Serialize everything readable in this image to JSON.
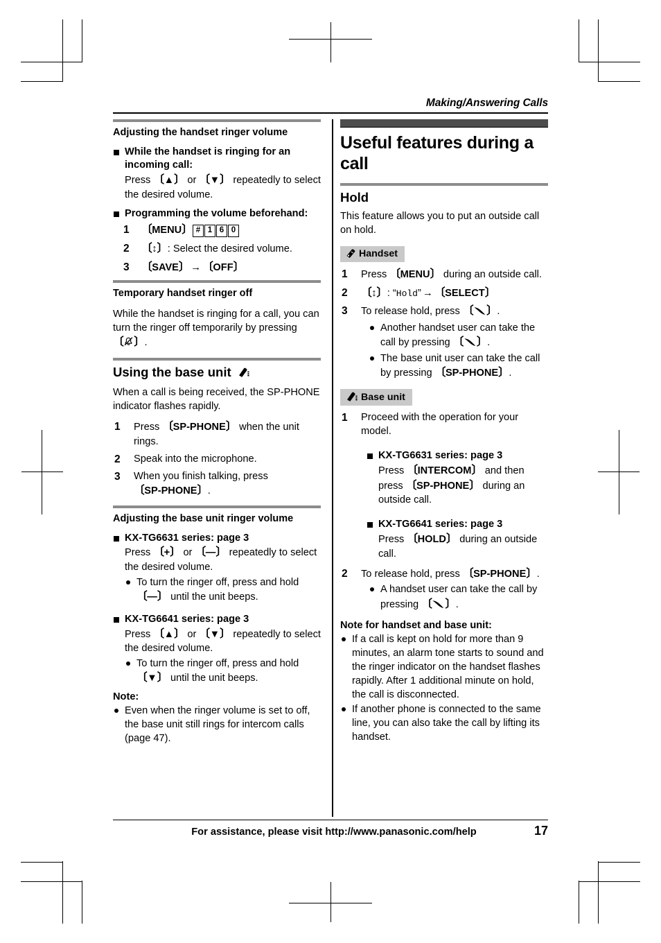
{
  "running_head": "Making/Answering Calls",
  "left_column": {
    "section1": {
      "heading": "Adjusting the handset ringer volume",
      "block1": {
        "heading": "While the handset is ringing for an incoming call:",
        "text_pre": "Press ",
        "key_up": "▲",
        "text_or": " or ",
        "key_down": "▼",
        "text_post": " repeatedly to select the desired volume."
      },
      "block2": {
        "heading": "Programming the volume beforehand:",
        "steps": [
          {
            "num": "1",
            "key": "MENU",
            "keypad": [
              "#",
              "1",
              "6",
              "0"
            ]
          },
          {
            "num": "2",
            "key_nav": "↕",
            "text": ": Select the desired volume."
          },
          {
            "num": "3",
            "key_a": "SAVE",
            "arrow": "→",
            "key_b": "OFF"
          }
        ]
      }
    },
    "section2": {
      "heading": "Temporary handset ringer off",
      "text_pre": "While the handset is ringing for a call, you can turn the ringer off temporarily by pressing ",
      "icon": "ringer-off-icon",
      "text_post": "."
    },
    "section3": {
      "heading": "Using the base unit",
      "heading_icon": "base-unit-icon",
      "intro": "When a call is being received, the SP-PHONE indicator flashes rapidly.",
      "steps": [
        {
          "num": "1",
          "text_pre": "Press ",
          "key": "SP-PHONE",
          "text_post": " when the unit rings."
        },
        {
          "num": "2",
          "text_pre": "Speak into the microphone."
        },
        {
          "num": "3",
          "text_pre": "When you finish talking, press ",
          "key": "SP-PHONE",
          "text_post": "."
        }
      ]
    },
    "section4": {
      "heading": "Adjusting the base unit ringer volume",
      "models": [
        {
          "heading": "KX-TG6631 series: page 3",
          "text_pre": "Press ",
          "key_a": "+",
          "text_or": " or ",
          "key_b": "—",
          "text_post": " repeatedly to select the desired volume.",
          "bullets": [
            {
              "text_pre": "To turn the ringer off, press and hold ",
              "key": "—",
              "text_post": " until the unit beeps."
            }
          ]
        },
        {
          "heading": "KX-TG6641 series: page 3",
          "text_pre": "Press ",
          "key_a": "▲",
          "text_or": " or ",
          "key_b": "▼",
          "text_post": " repeatedly to select the desired volume.",
          "bullets": [
            {
              "text_pre": "To turn the ringer off, press and hold ",
              "key": "▼",
              "text_post": " until the unit beeps."
            }
          ]
        }
      ],
      "note_label": "Note:",
      "notes": [
        "Even when the ringer volume is set to off, the base unit still rings for intercom calls (page 47)."
      ]
    }
  },
  "right_column": {
    "chapter_title": "Useful features during a call",
    "section_hold": {
      "heading": "Hold",
      "intro": "This feature allows you to put an outside call on hold.",
      "handset_badge": {
        "label": "Handset",
        "icon": "handset-icon"
      },
      "handset_steps": [
        {
          "num": "1",
          "text_pre": "Press ",
          "key": "MENU",
          "text_post": " during an outside call."
        },
        {
          "num": "2",
          "key_nav": "↕",
          "text_mid": ": ",
          "lcd": "Hold",
          "arrow": "→",
          "key_b": "SELECT"
        },
        {
          "num": "3",
          "text_pre": "To release hold, press ",
          "key_talk": "talk-icon",
          "text_post": ".",
          "bullets": [
            {
              "text_pre": "Another handset user can take the call by pressing ",
              "key_talk": "talk-icon",
              "text_post": "."
            },
            {
              "text_pre": "The base unit user can take the call by pressing ",
              "key": "SP-PHONE",
              "text_post": "."
            }
          ]
        }
      ],
      "base_badge": {
        "label": "Base unit",
        "icon": "base-unit-icon"
      },
      "base_steps": [
        {
          "num": "1",
          "text_pre": "Proceed with the operation for your model.",
          "models": [
            {
              "heading": "KX-TG6631 series: page 3",
              "text_pre": "Press ",
              "key_a": "INTERCOM",
              "text_mid": " and then press ",
              "key_b": "SP-PHONE",
              "text_post": " during an outside call."
            },
            {
              "heading": "KX-TG6641 series: page 3",
              "text_pre": "Press ",
              "key_a": "HOLD",
              "text_post": " during an outside call."
            }
          ]
        },
        {
          "num": "2",
          "text_pre": "To release hold, press ",
          "key": "SP-PHONE",
          "text_post": ".",
          "bullets": [
            {
              "text_pre": "A handset user can take the call by pressing ",
              "key_talk": "talk-icon",
              "text_post": "."
            }
          ]
        }
      ],
      "note_label": "Note for handset and base unit:",
      "notes": [
        "If a call is kept on hold for more than 9 minutes, an alarm tone starts to sound and the ringer indicator on the handset flashes rapidly. After 1 additional minute on hold, the call is disconnected.",
        "If another phone is connected to the same line, you can also take the call by lifting its handset."
      ]
    }
  },
  "footer": {
    "text": "For assistance, please visit http://www.panasonic.com/help",
    "page_number": "17"
  },
  "colors": {
    "chapter_bar": "#4d4d4d",
    "section_rule": "#8c8c8c",
    "badge_background": "#c9c9c9",
    "text": "#000000"
  }
}
